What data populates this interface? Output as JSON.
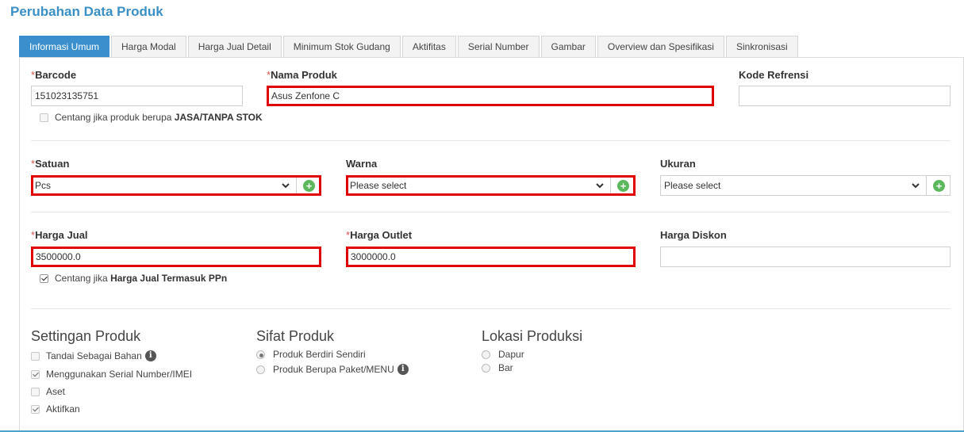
{
  "page": {
    "title": "Perubahan Data Produk"
  },
  "tabs": [
    {
      "label": "Informasi Umum",
      "active": true
    },
    {
      "label": "Harga Modal"
    },
    {
      "label": "Harga Jual Detail"
    },
    {
      "label": "Minimum Stok Gudang"
    },
    {
      "label": "Aktifitas"
    },
    {
      "label": "Serial Number"
    },
    {
      "label": "Gambar"
    },
    {
      "label": "Overview dan Spesifikasi"
    },
    {
      "label": "Sinkronisasi"
    }
  ],
  "form": {
    "required_mark": "*",
    "barcode": {
      "label": "Barcode",
      "value": "151023135751"
    },
    "nama_produk": {
      "label": "Nama Produk",
      "value": "Asus Zenfone C"
    },
    "kode_refrensi": {
      "label": "Kode Refrensi",
      "value": ""
    },
    "jasa_check": {
      "prefix": "Centang jika produk berupa",
      "bold": "JASA/TANPA STOK",
      "checked": false
    },
    "satuan": {
      "label": "Satuan",
      "value": "Pcs"
    },
    "warna": {
      "label": "Warna",
      "value": "Please select"
    },
    "ukuran": {
      "label": "Ukuran",
      "value": "Please select"
    },
    "harga_jual": {
      "label": "Harga Jual",
      "value": "3500000.0"
    },
    "harga_outlet": {
      "label": "Harga Outlet",
      "value": "3000000.0"
    },
    "harga_diskon": {
      "label": "Harga Diskon",
      "value": ""
    },
    "ppn_check": {
      "prefix": "Centang jika",
      "bold": "Harga Jual Termasuk PPn",
      "checked": true
    }
  },
  "settingan": {
    "title": "Settingan Produk",
    "items": [
      {
        "label": "Tandai Sebagai Bahan",
        "checked": false
      },
      {
        "label": "Menggunakan Serial Number/IMEI",
        "checked": true
      },
      {
        "label": "Aset",
        "checked": false
      },
      {
        "label": "Aktifkan",
        "checked": true
      }
    ]
  },
  "sifat": {
    "title": "Sifat Produk",
    "options": [
      {
        "label": "Produk Berdiri Sendiri",
        "selected": true
      },
      {
        "label": "Produk Berupa Paket/MENU",
        "selected": false
      }
    ]
  },
  "lokasi": {
    "title": "Lokasi Produksi",
    "options": [
      {
        "label": "Dapur",
        "selected": false
      },
      {
        "label": "Bar",
        "selected": false
      }
    ]
  },
  "icons": {
    "add": "plus-circle-icon",
    "info": "info-icon",
    "dropdown": "chevron-down-icon"
  },
  "colors": {
    "accent": "#3a8fcc",
    "highlight": "#e00000",
    "add": "#5cb85c"
  }
}
